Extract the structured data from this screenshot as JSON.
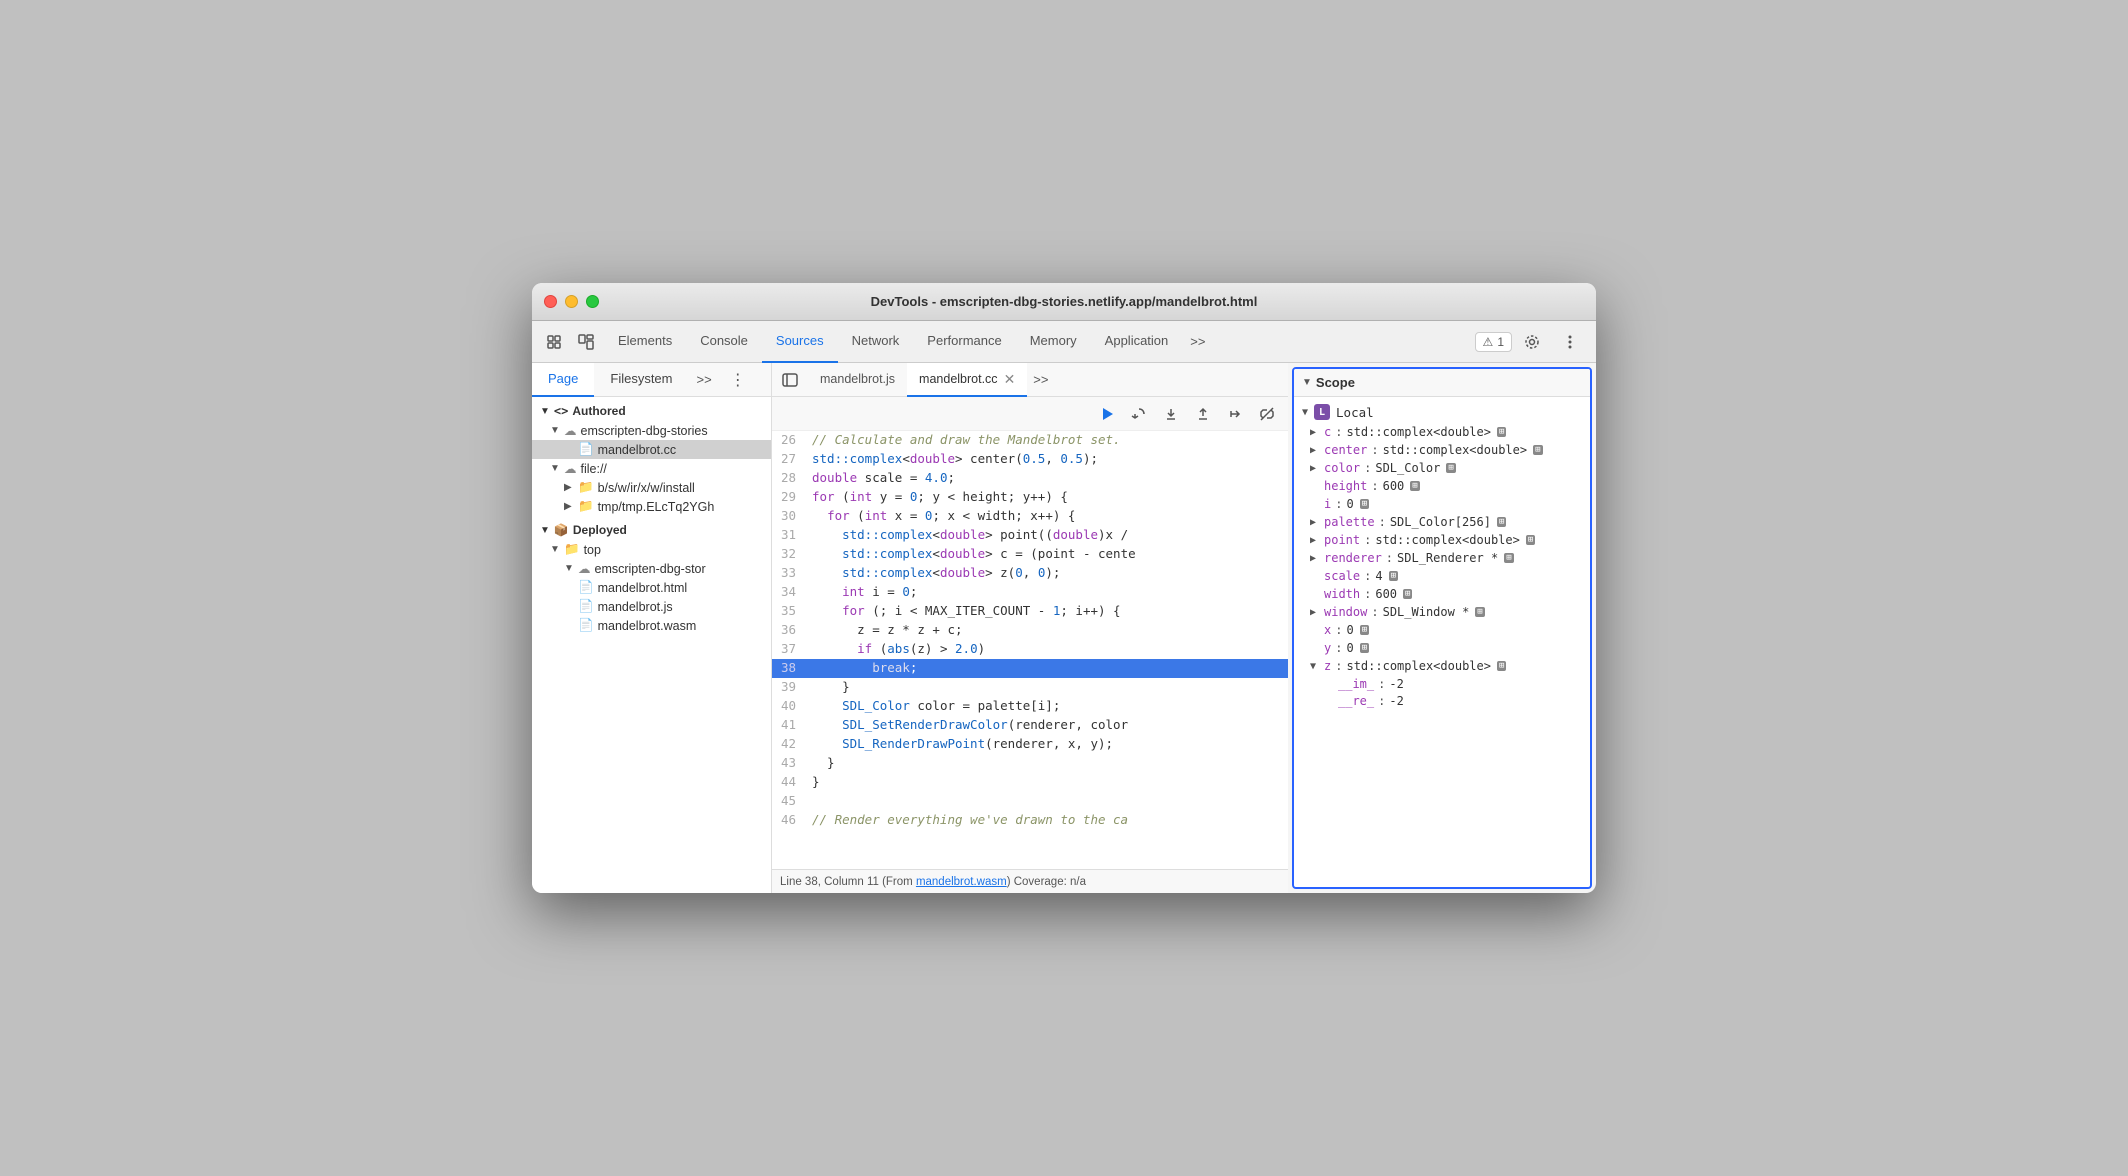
{
  "window": {
    "title": "DevTools - emscripten-dbg-stories.netlify.app/mandelbrot.html"
  },
  "devtools_tabs": {
    "items": [
      {
        "label": "Elements",
        "active": false
      },
      {
        "label": "Console",
        "active": false
      },
      {
        "label": "Sources",
        "active": true
      },
      {
        "label": "Network",
        "active": false
      },
      {
        "label": "Performance",
        "active": false
      },
      {
        "label": "Memory",
        "active": false
      },
      {
        "label": "Application",
        "active": false
      }
    ],
    "more_label": ">>",
    "warning_count": "1"
  },
  "secondary_tabs": {
    "items": [
      {
        "label": "Page",
        "active": true
      },
      {
        "label": "Filesystem",
        "active": false
      }
    ],
    "more_label": ">>",
    "dots_label": "⋮"
  },
  "file_tree": {
    "items": [
      {
        "indent": 0,
        "arrow": "▼",
        "icon": "<>",
        "label": "Authored",
        "type": "section"
      },
      {
        "indent": 1,
        "arrow": "▼",
        "icon": "cloud",
        "label": "emscripten-dbg-stories",
        "type": "folder"
      },
      {
        "indent": 2,
        "arrow": "",
        "icon": "file-cc",
        "label": "mandelbrot.cc",
        "type": "file",
        "selected": true
      },
      {
        "indent": 1,
        "arrow": "▼",
        "icon": "cloud",
        "label": "file://",
        "type": "folder"
      },
      {
        "indent": 2,
        "arrow": "▶",
        "icon": "folder",
        "label": "b/s/w/ir/x/w/install",
        "type": "folder"
      },
      {
        "indent": 2,
        "arrow": "▶",
        "icon": "folder",
        "label": "tmp/tmp.ELcTq2YGh",
        "type": "folder"
      },
      {
        "indent": 0,
        "arrow": "▼",
        "icon": "box",
        "label": "Deployed",
        "type": "section"
      },
      {
        "indent": 1,
        "arrow": "▼",
        "icon": "folder",
        "label": "top",
        "type": "folder"
      },
      {
        "indent": 2,
        "arrow": "▼",
        "icon": "cloud",
        "label": "emscripten-dbg-stor",
        "type": "folder"
      },
      {
        "indent": 3,
        "arrow": "",
        "icon": "file-html",
        "label": "mandelbrot.html",
        "type": "file"
      },
      {
        "indent": 3,
        "arrow": "",
        "icon": "file-js",
        "label": "mandelbrot.js",
        "type": "file"
      },
      {
        "indent": 3,
        "arrow": "",
        "icon": "file-wasm",
        "label": "mandelbrot.wasm",
        "type": "file"
      }
    ]
  },
  "code_tabs": {
    "items": [
      {
        "label": "mandelbrot.js",
        "active": false,
        "closable": false
      },
      {
        "label": "mandelbrot.cc",
        "active": true,
        "closable": true
      }
    ],
    "more_label": ">>"
  },
  "code": {
    "lines": [
      {
        "num": "29",
        "text": "",
        "highlighted": false
      },
      {
        "num": "26",
        "raw": "// Calculate and draw the Mandelbrot set.",
        "comment": true
      },
      {
        "num": "27",
        "raw": "std::complex<double> center(0.5, 0.5);"
      },
      {
        "num": "28",
        "raw": "double scale = 4.0;"
      },
      {
        "num": "29",
        "raw": "for (int y = 0; y < height; y++) {"
      },
      {
        "num": "30",
        "raw": "  for (int x = 0; x < width; x++) {"
      },
      {
        "num": "31",
        "raw": "    std::complex<double> point((double)x /"
      },
      {
        "num": "32",
        "raw": "    std::complex<double> c = (point - cente"
      },
      {
        "num": "33",
        "raw": "    std::complex<double> z(0, 0);"
      },
      {
        "num": "34",
        "raw": "    int i = 0;"
      },
      {
        "num": "35",
        "raw": "    for (; i < MAX_ITER_COUNT - 1; i++) {"
      },
      {
        "num": "36",
        "raw": "      z = z * z + c;"
      },
      {
        "num": "37",
        "raw": "      if (abs(z) > 2.0)"
      },
      {
        "num": "38",
        "raw": "        break;",
        "highlighted": true
      },
      {
        "num": "39",
        "raw": "    }"
      },
      {
        "num": "40",
        "raw": "    SDL_Color color = palette[i];"
      },
      {
        "num": "41",
        "raw": "    SDL_SetRenderDrawColor(renderer, color"
      },
      {
        "num": "42",
        "raw": "    SDL_RenderDrawPoint(renderer, x, y);"
      },
      {
        "num": "43",
        "raw": "  }"
      },
      {
        "num": "44",
        "raw": "}"
      },
      {
        "num": "45",
        "raw": ""
      },
      {
        "num": "46",
        "raw": "// Render everything we've drawn to the ca"
      }
    ]
  },
  "status_bar": {
    "text": "Line 38, Column 11 (From ",
    "link": "mandelbrot.wasm",
    "text2": ") Coverage: n/a"
  },
  "scope": {
    "header": "Scope",
    "local_label": "Local",
    "items": [
      {
        "arrow": "▶",
        "key": "c",
        "val": "std::complex<double>",
        "badge": true
      },
      {
        "arrow": "▶",
        "key": "center",
        "val": "std::complex<double>",
        "badge": true
      },
      {
        "arrow": "▶",
        "key": "color",
        "val": "SDL_Color",
        "badge": true
      },
      {
        "arrow": "",
        "key": "height",
        "val": "600",
        "badge": true
      },
      {
        "arrow": "",
        "key": "i",
        "val": "0",
        "badge": true
      },
      {
        "arrow": "▶",
        "key": "palette",
        "val": "SDL_Color[256]",
        "badge": true
      },
      {
        "arrow": "▶",
        "key": "point",
        "val": "std::complex<double>",
        "badge": true
      },
      {
        "arrow": "▶",
        "key": "renderer",
        "val": "SDL_Renderer *",
        "badge": true
      },
      {
        "arrow": "",
        "key": "scale",
        "val": "4",
        "badge": true
      },
      {
        "arrow": "",
        "key": "width",
        "val": "600",
        "badge": true
      },
      {
        "arrow": "▶",
        "key": "window",
        "val": "SDL_Window *",
        "badge": true
      },
      {
        "arrow": "",
        "key": "x",
        "val": "0",
        "badge": true
      },
      {
        "arrow": "",
        "key": "y",
        "val": "0",
        "badge": true
      },
      {
        "arrow": "▼",
        "key": "z",
        "val": "std::complex<double>",
        "badge": true
      },
      {
        "arrow": "",
        "key": "__im_",
        "val": "-2",
        "badge": false,
        "sub": true
      },
      {
        "arrow": "",
        "key": "__re_",
        "val": "-2",
        "badge": false,
        "sub": true
      }
    ]
  }
}
